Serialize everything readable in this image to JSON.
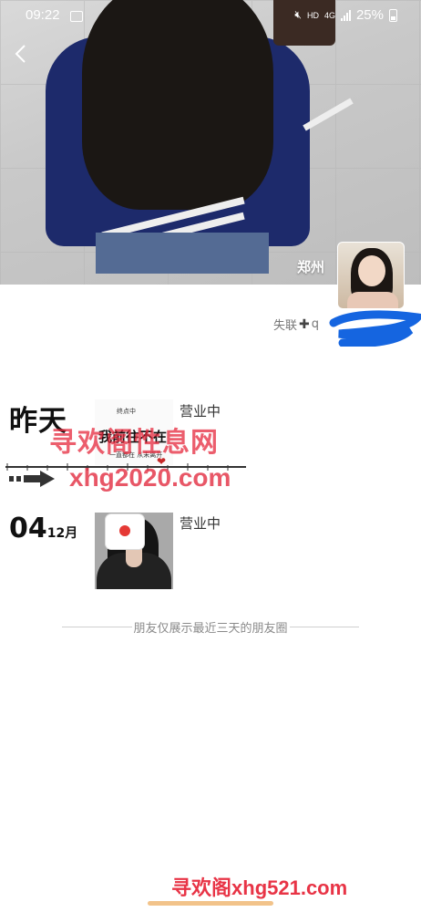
{
  "status_bar": {
    "time": "09:22",
    "network_hd": "HD",
    "network_4g": "4G",
    "battery": "25%"
  },
  "profile": {
    "city": "郑州",
    "signature_prefix": "失联",
    "signature_after_plus": "q"
  },
  "feed": {
    "posts": [
      {
        "date_label": "昨天",
        "status": "营业中",
        "image_text_top": "终点中",
        "image_text_main": "我前往不在",
        "image_text_bottom": "一直都在 从未离开"
      },
      {
        "date_day": "04",
        "date_month": "12月",
        "status": "营业中"
      }
    ],
    "footer_note": "朋友仅展示最近三天的朋友圈"
  },
  "watermarks": {
    "site_cn": "寻欢阁性息网",
    "site_url": "xhg2020.com",
    "bottom_cn": "寻欢阁",
    "bottom_url": "xhg521.com"
  },
  "colors": {
    "watermark_red": "#e6283c",
    "home_bar": "#f2c38a",
    "sweater_navy": "#1d2a6b"
  }
}
